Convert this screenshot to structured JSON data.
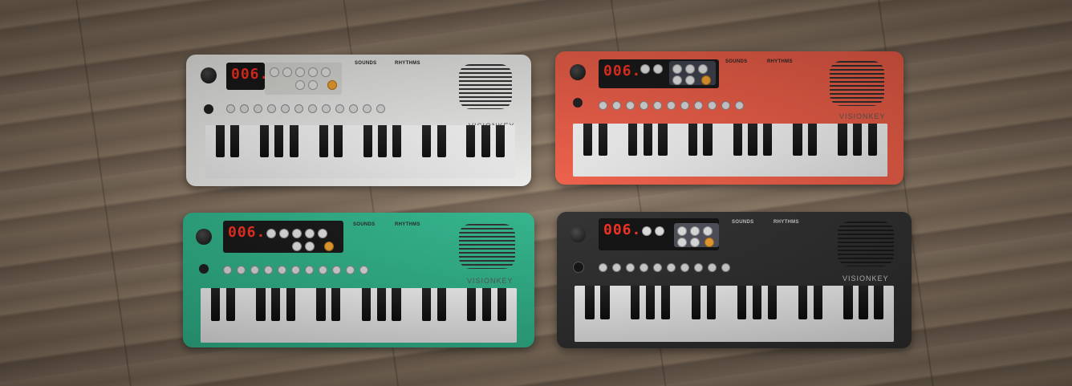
{
  "keyboards": [
    {
      "id": "white",
      "body_color": "#ececea",
      "led_text": "006.",
      "sounds_header": "SOUNDS",
      "rhythms_header": "RHYTHMS",
      "brand": "VISIONKEY",
      "dark": false
    },
    {
      "id": "coral",
      "body_color": "#f05a43",
      "led_text": "006.",
      "sounds_header": "SOUNDS",
      "rhythms_header": "RHYTHMS",
      "brand": "VISIONKEY",
      "dark": false
    },
    {
      "id": "green",
      "body_color": "#2bb58a",
      "led_text": "006.",
      "sounds_header": "SOUNDS",
      "rhythms_header": "RHYTHMS",
      "brand": "VISIONKEY",
      "dark": false
    },
    {
      "id": "black",
      "body_color": "#2a2a2a",
      "led_text": "006.",
      "sounds_header": "SOUNDS",
      "rhythms_header": "RHYTHMS",
      "brand": "VISIONKEY",
      "dark": true
    }
  ]
}
